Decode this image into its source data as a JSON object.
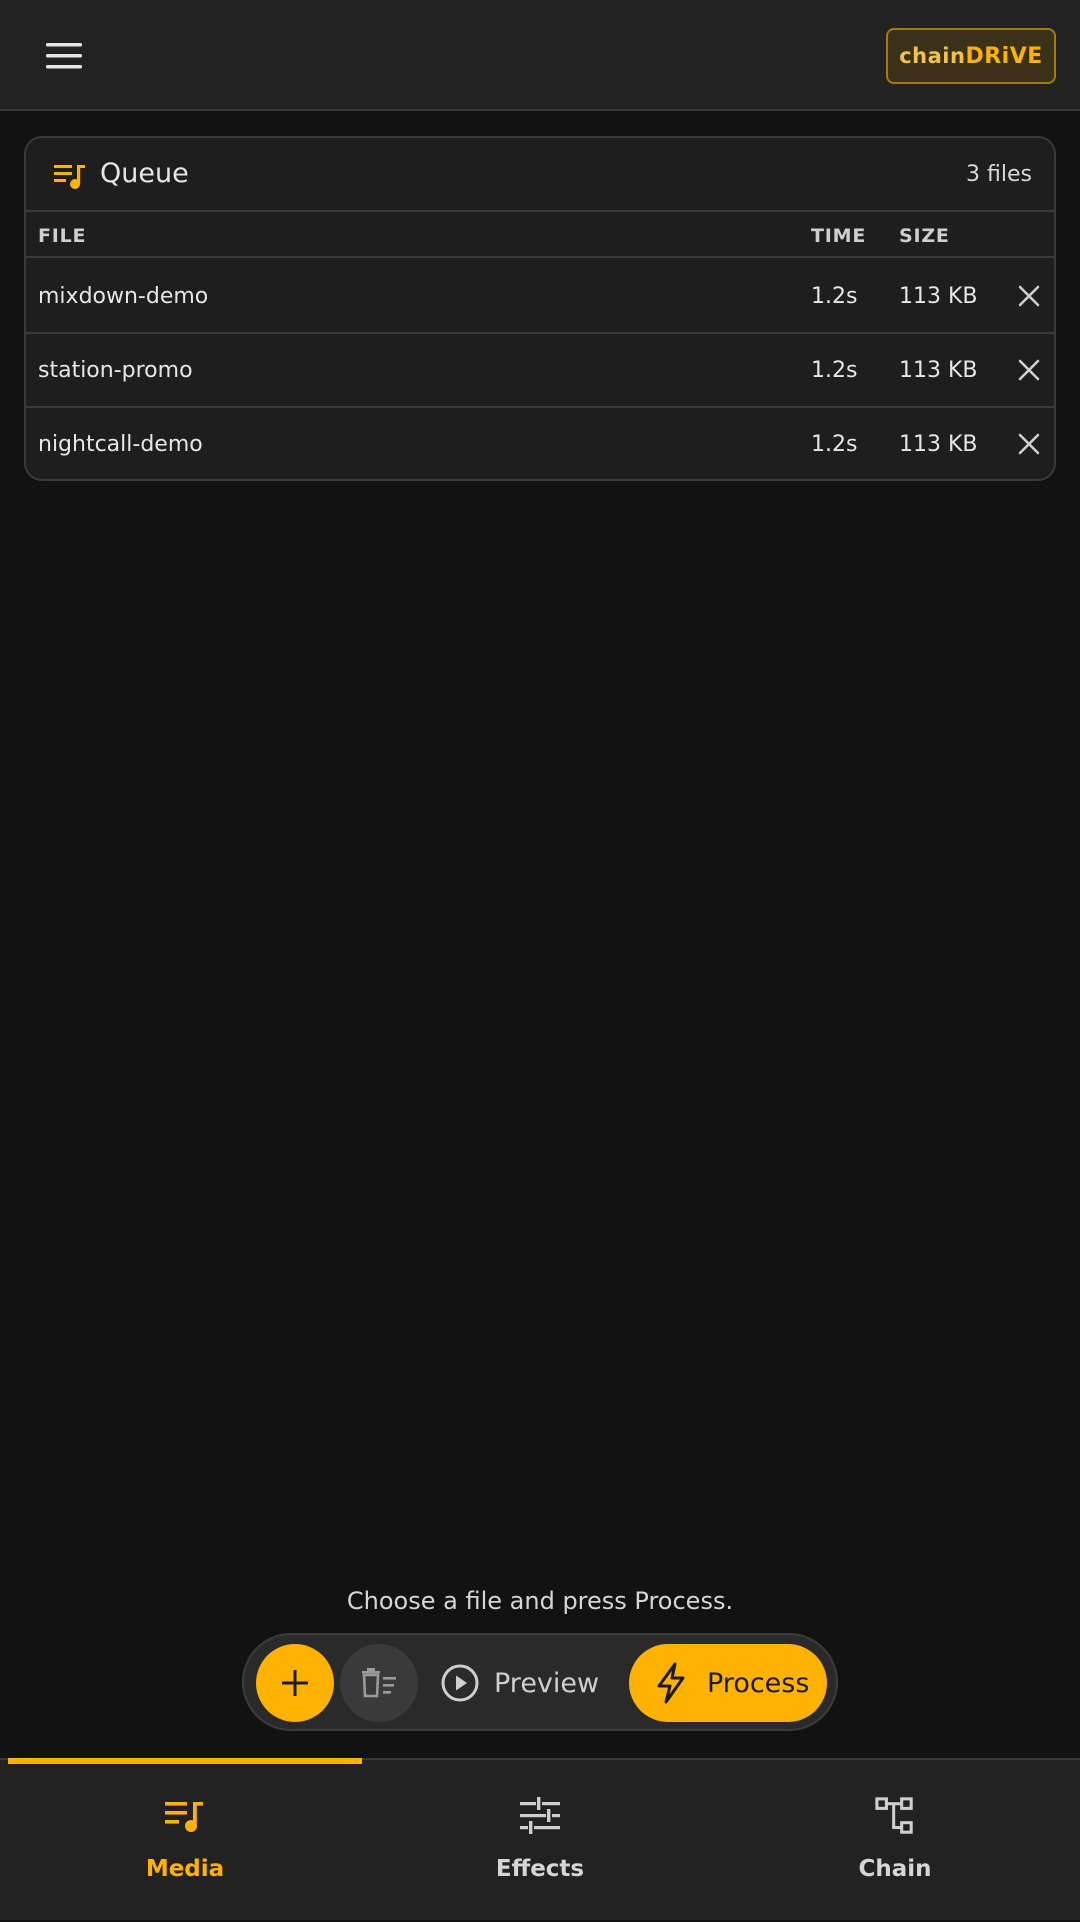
{
  "header": {
    "logo_part1": "chain",
    "logo_part2": "DRiVE"
  },
  "queue": {
    "title": "Queue",
    "count": "3 files",
    "columns": {
      "file": "FILE",
      "time": "TIME",
      "size": "SIZE"
    },
    "rows": [
      {
        "file": "mixdown-demo",
        "time": "1.2s",
        "size": "113 KB"
      },
      {
        "file": "station-promo",
        "time": "1.2s",
        "size": "113 KB"
      },
      {
        "file": "nightcall-demo",
        "time": "1.2s",
        "size": "113 KB"
      }
    ]
  },
  "actions": {
    "hint": "Choose a file and press Process.",
    "preview_label": "Preview",
    "process_label": "Process"
  },
  "nav": {
    "items": [
      {
        "label": "Media",
        "active": true
      },
      {
        "label": "Effects",
        "active": false
      },
      {
        "label": "Chain",
        "active": false
      }
    ]
  },
  "colors": {
    "accent": "#ffb300",
    "background": "#121212",
    "surface": "#1e1e1e",
    "text": "#e6e6e6"
  },
  "icons": {
    "menu": "hamburger-menu-icon",
    "queue": "queue-music-icon",
    "remove": "close-icon",
    "add": "plus-icon",
    "clear": "clear-queue-icon",
    "preview": "play-circle-icon",
    "process": "lightning-bolt-icon",
    "media": "queue-music-icon",
    "effects": "sliders-icon",
    "chain": "chain-nodes-icon"
  }
}
